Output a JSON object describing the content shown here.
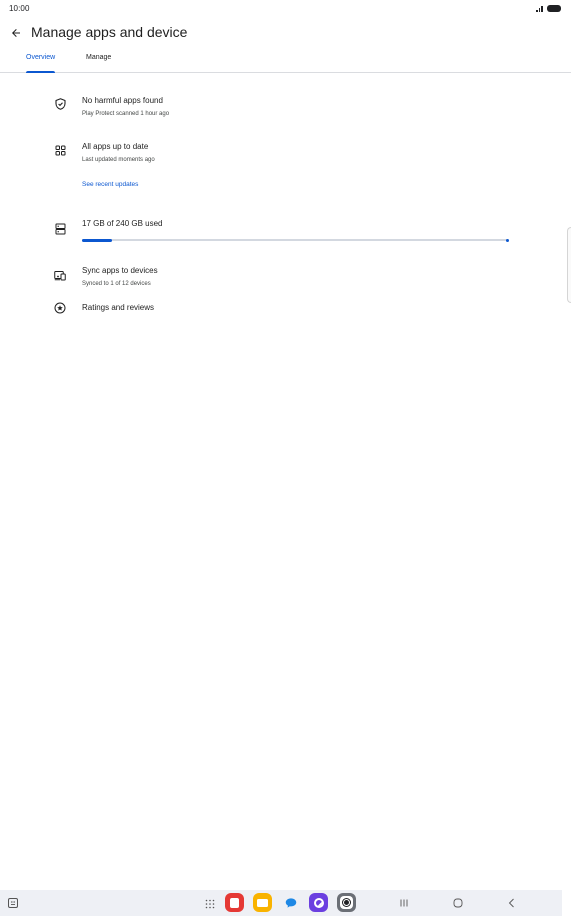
{
  "status_bar": {
    "time": "10:00",
    "icons": [
      "signal-icon",
      "battery-icon"
    ]
  },
  "app_bar": {
    "back_icon": "arrow-back-icon",
    "title": "Manage apps and device"
  },
  "tabs": [
    {
      "label": "Overview",
      "active": true
    },
    {
      "label": "Manage",
      "active": false
    }
  ],
  "overview": {
    "protect": {
      "icon": "shield-icon",
      "title": "No harmful apps found",
      "subtitle": "Play Protect scanned 1 hour ago"
    },
    "updates": {
      "icon": "apps-grid-icon",
      "title": "All apps up to date",
      "subtitle": "Last updated moments ago",
      "link": "See recent updates"
    },
    "storage": {
      "icon": "storage-icon",
      "title": "17 GB of 240 GB used",
      "used_gb": 17,
      "total_gb": 240,
      "used_fraction": 0.071
    },
    "sync": {
      "icon": "sync-devices-icon",
      "title": "Sync apps to devices",
      "subtitle": "Synced to 1 of 12 devices"
    },
    "ratings": {
      "icon": "star-circle-icon",
      "title": "Ratings and reviews"
    }
  },
  "taskbar": {
    "left_icon": "keyboard-icon",
    "apps": [
      {
        "name": "apps-drawer-icon"
      },
      {
        "name": "red-app-icon",
        "color": "#e53935"
      },
      {
        "name": "yellow-app-icon",
        "color": "#f9b300"
      },
      {
        "name": "messages-app-icon",
        "color": "#1e88e5"
      },
      {
        "name": "purple-app-icon",
        "color": "#6b3fe0"
      },
      {
        "name": "camera-app-icon",
        "color": "#6b6f76"
      }
    ],
    "nav": [
      "recents-icon",
      "home-icon",
      "back-icon"
    ]
  },
  "colors": {
    "accent": "#0b57d0",
    "text": "#1f1f1f",
    "secondary_text": "#444746",
    "divider": "#dadce0",
    "taskbar": "#eef0f5"
  }
}
